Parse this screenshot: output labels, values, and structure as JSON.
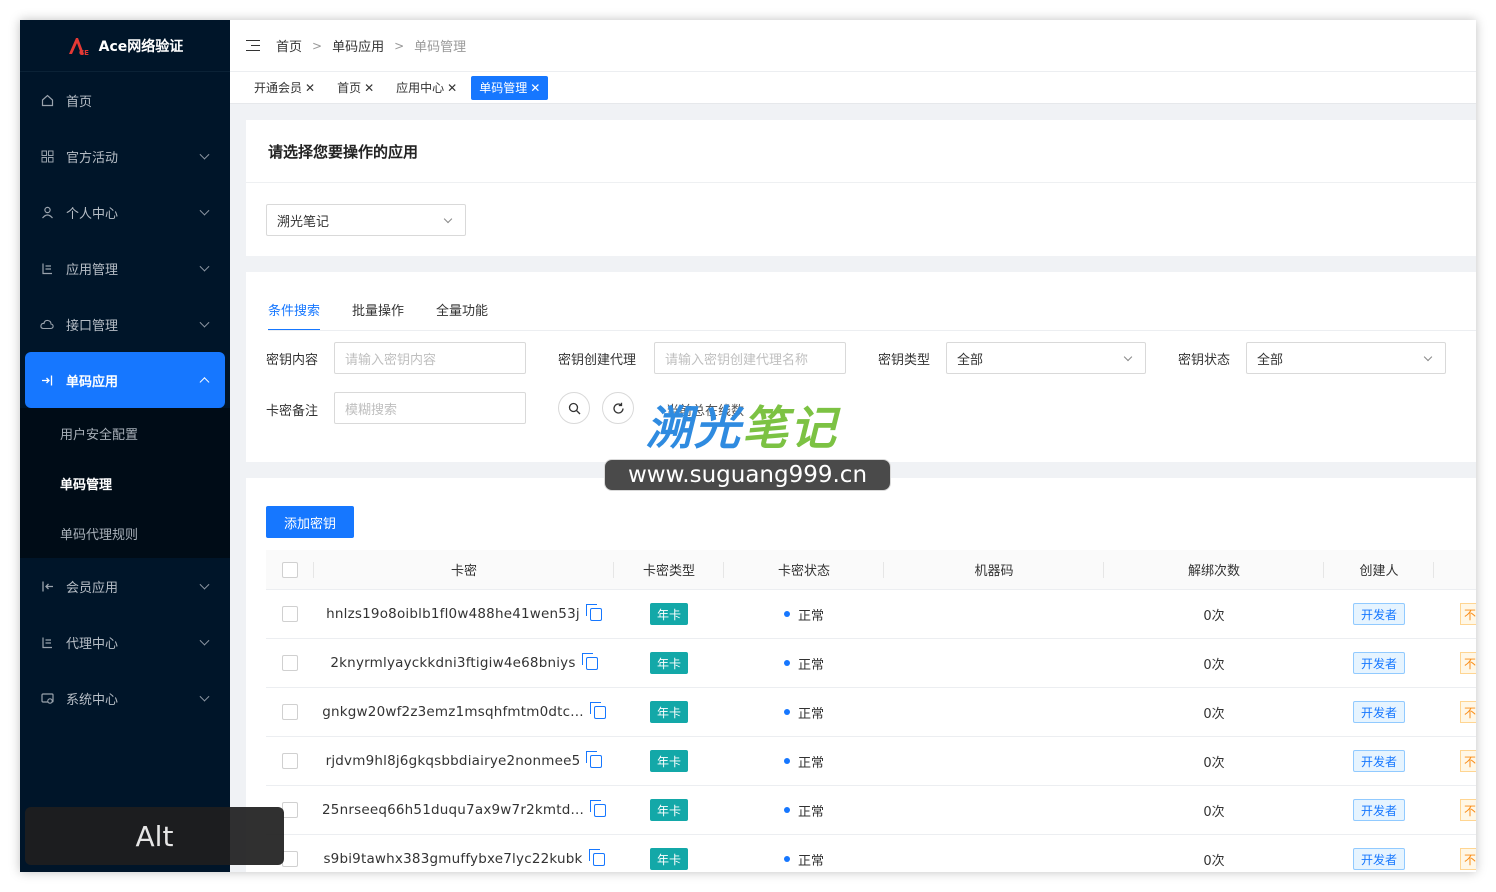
{
  "app": {
    "title": "Ace网络验证"
  },
  "sidebar": {
    "items": [
      {
        "label": "首页",
        "icon": "home-icon",
        "expandable": false
      },
      {
        "label": "官方活动",
        "icon": "apps-icon",
        "expandable": true
      },
      {
        "label": "个人中心",
        "icon": "user-icon",
        "expandable": true
      },
      {
        "label": "应用管理",
        "icon": "list-icon",
        "expandable": true
      },
      {
        "label": "接口管理",
        "icon": "cloud-icon",
        "expandable": true
      },
      {
        "label": "单码应用",
        "icon": "login-icon",
        "expandable": true,
        "active": true
      },
      {
        "label": "会员应用",
        "icon": "logout-icon",
        "expandable": true
      },
      {
        "label": "代理中心",
        "icon": "list-icon",
        "expandable": true
      },
      {
        "label": "系统中心",
        "icon": "settings-icon",
        "expandable": true
      }
    ],
    "submenu": [
      {
        "label": "用户安全配置"
      },
      {
        "label": "单码管理",
        "current": true
      },
      {
        "label": "单码代理规则"
      }
    ]
  },
  "breadcrumb": [
    "首页",
    "单码应用",
    "单码管理"
  ],
  "tabs": [
    {
      "label": "开通会员"
    },
    {
      "label": "首页"
    },
    {
      "label": "应用中心"
    },
    {
      "label": "单码管理",
      "active": true
    }
  ],
  "app_select": {
    "heading": "请选择您要操作的应用",
    "value": "溯光笔记"
  },
  "search": {
    "tabs": [
      "条件搜索",
      "批量操作",
      "全量功能"
    ],
    "key_content_label": "密钥内容",
    "key_content_placeholder": "请输入密钥内容",
    "agent_label": "密钥创建代理",
    "agent_placeholder": "请输入密钥创建代理名称",
    "type_label": "密钥类型",
    "type_value": "全部",
    "status_label": "密钥状态",
    "status_value": "全部",
    "note_label": "卡密备注",
    "note_placeholder": "模糊搜索",
    "total_text": "当前总在线数"
  },
  "table": {
    "add_button": "添加密钥",
    "columns": [
      "卡密",
      "卡密类型",
      "卡密状态",
      "机器码",
      "解绑次数",
      "创建人"
    ],
    "rows": [
      {
        "key": "hnlzs19o8oiblb1fl0w488he41wen53j",
        "type": "年卡",
        "status": "正常",
        "machine": "",
        "unbind": "0次",
        "creator": "开发者",
        "extra": "不"
      },
      {
        "key": "2knyrmlyayckkdni3ftigiw4e68bniys",
        "type": "年卡",
        "status": "正常",
        "machine": "",
        "unbind": "0次",
        "creator": "开发者",
        "extra": "不"
      },
      {
        "key": "gnkgw20wf2z3emz1msqhfmtm0dtc...",
        "type": "年卡",
        "status": "正常",
        "machine": "",
        "unbind": "0次",
        "creator": "开发者",
        "extra": "不"
      },
      {
        "key": "rjdvm9hl8j6gkqsbbdiairye2nonmee5",
        "type": "年卡",
        "status": "正常",
        "machine": "",
        "unbind": "0次",
        "creator": "开发者",
        "extra": "不"
      },
      {
        "key": "25nrseeq66h51duqu7ax9w7r2kmtd...",
        "type": "年卡",
        "status": "正常",
        "machine": "",
        "unbind": "0次",
        "creator": "开发者",
        "extra": "不"
      },
      {
        "key": "s9bi9tawhx383gmuffybxe7lyc22kubk",
        "type": "年卡",
        "status": "正常",
        "machine": "",
        "unbind": "0次",
        "creator": "开发者",
        "extra": "不"
      }
    ]
  },
  "watermark": {
    "title_a": "溯光",
    "title_b": "笔记",
    "url": "www.suguang999.cn"
  },
  "overlay": {
    "key_hint": "Alt"
  },
  "colors": {
    "sidebar_bg": "#001529",
    "accent": "#1677ff",
    "tag_year": "#13a8a8"
  }
}
